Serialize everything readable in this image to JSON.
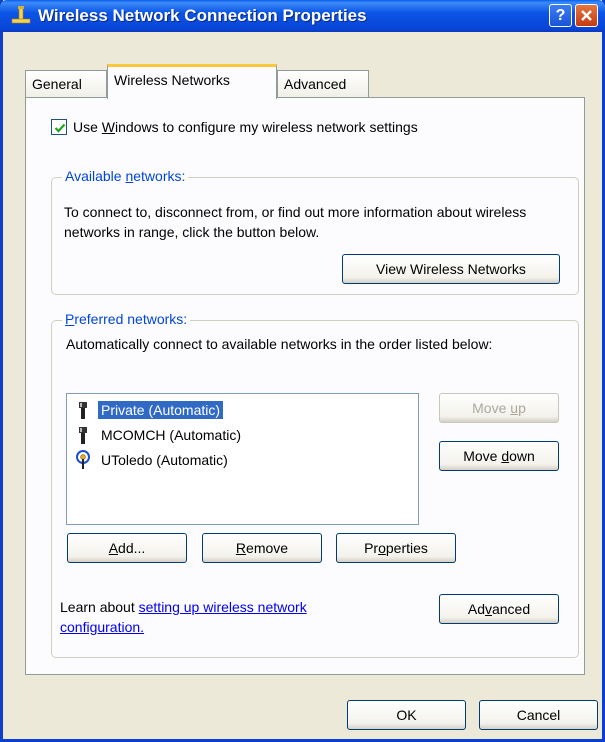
{
  "window": {
    "title": "Wireless Network Connection Properties"
  },
  "tabs": [
    {
      "label": "General"
    },
    {
      "label": "Wireless Networks"
    },
    {
      "label": "Advanced"
    }
  ],
  "config": {
    "checkbox_checked": true,
    "label_pre": "Use ",
    "label_key": "W",
    "label_post": "indows to configure my wireless network settings"
  },
  "available": {
    "legend_pre": "Available ",
    "legend_key": "n",
    "legend_post": "etworks:",
    "description": "To connect to, disconnect from, or find out more information about wireless networks in range, click the button below.",
    "view_button": "View Wireless Networks"
  },
  "preferred": {
    "legend_pre": "",
    "legend_key": "P",
    "legend_post": "referred networks:",
    "description": "Automatically connect to available networks in the order listed below:",
    "networks": [
      {
        "name": "Private (Automatic)",
        "icon": "antenna-icon",
        "selected": true
      },
      {
        "name": "MCOMCH (Automatic)",
        "icon": "antenna-icon",
        "selected": false
      },
      {
        "name": "UToledo (Automatic)",
        "icon": "wireless-signal-icon",
        "selected": false
      }
    ],
    "move_up": {
      "pre": "Move ",
      "key": "u",
      "post": "p",
      "enabled": false
    },
    "move_down": {
      "pre": "Move ",
      "key": "d",
      "post": "own",
      "enabled": true
    },
    "add": {
      "pre": "",
      "key": "A",
      "post": "dd..."
    },
    "remove": {
      "pre": "",
      "key": "R",
      "post": "emove"
    },
    "properties": {
      "pre": "Pr",
      "key": "o",
      "post": "perties"
    },
    "learn_prefix": "Learn about ",
    "learn_link": "setting up wireless network configuration.",
    "advanced": {
      "pre": "Ad",
      "key": "v",
      "post": "anced"
    }
  },
  "footer": {
    "ok": "OK",
    "cancel": "Cancel"
  },
  "colors": {
    "titlebar": "#0a55e6",
    "selection": "#316ac5",
    "link": "#0000ee",
    "legend": "#0046d5",
    "tab_highlight": "#ffc83c"
  }
}
